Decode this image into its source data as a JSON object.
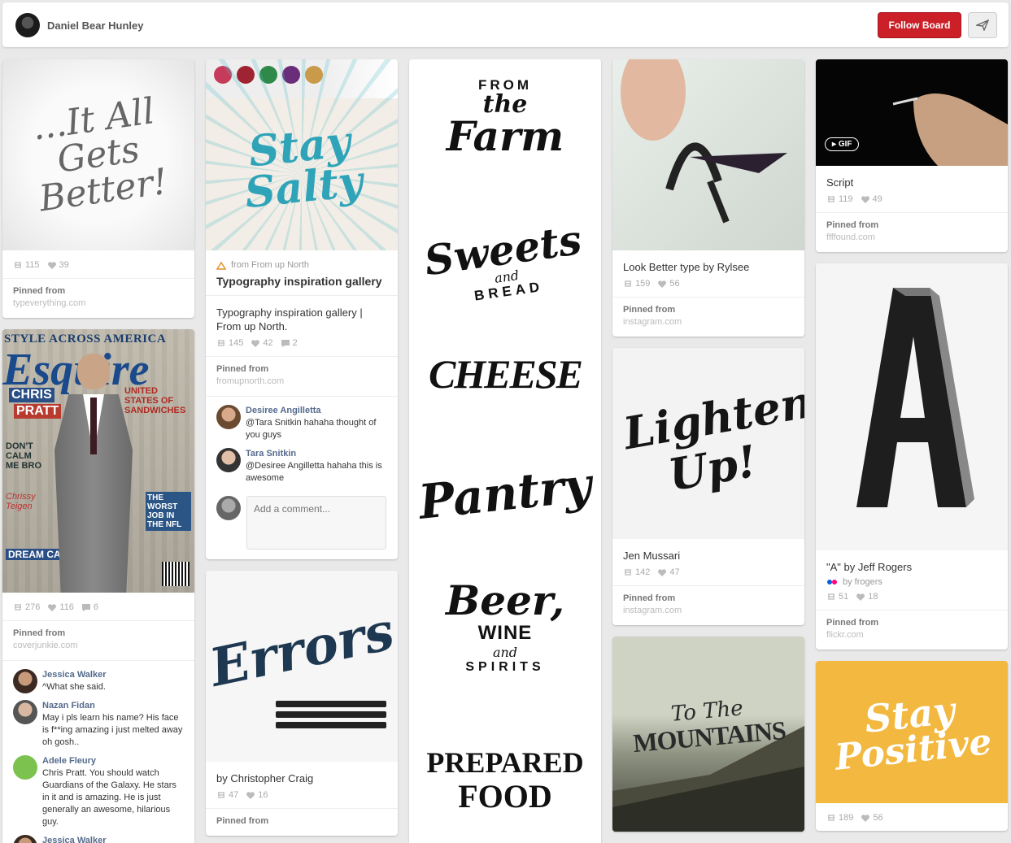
{
  "board": {
    "owner_name": "Daniel Bear Hunley",
    "follow_label": "Follow Board"
  },
  "columns": {
    "c1": {
      "pin1": {
        "likes_repins": "115",
        "likes": "39",
        "pinned_label": "Pinned from",
        "source": "typeverything.com",
        "art": "...It All Gets Better!"
      },
      "pin2": {
        "repins": "276",
        "likes": "116",
        "comments": "6",
        "pinned_label": "Pinned from",
        "source": "coverjunkie.com",
        "cover": {
          "top": "STYLE ACROSS AMERICA",
          "mast": "Esquire",
          "left1": "CHRIS",
          "left2": "PRATT",
          "right": "UNITED STATES OF SANDWICHES",
          "left3": "DON'T CALM ME BRO",
          "left4": "Chrissy Teigen",
          "left5": "DREAM CAR",
          "right2": "THE WORST JOB IN THE NFL"
        },
        "comments_list": [
          {
            "name": "Jessica Walker",
            "text": "^What she said."
          },
          {
            "name": "Nazan Fidan",
            "text": "May i pls learn his name? His face is f**ing amazing i just melted away oh gosh.."
          },
          {
            "name": "Adele Fleury",
            "text": "Chris Pratt. You should watch Guardians of the Galaxy. He stars in it and is amazing. He is just generally an awesome, hilarious guy."
          },
          {
            "name": "Jessica Walker",
            "text": ""
          }
        ]
      }
    },
    "c2": {
      "pin1": {
        "source_from": "from From up North",
        "title": "Typography inspiration gallery",
        "desc": "Typography inspiration gallery | From up North.",
        "repins": "145",
        "likes": "42",
        "comments": "2",
        "pinned_label": "Pinned from",
        "source": "fromupnorth.com",
        "art": "Stay Salty",
        "comments_list": [
          {
            "name": "Desiree Angilletta",
            "text": "@Tara Snitkin hahaha thought of you guys"
          },
          {
            "name": "Tara Snitkin",
            "text": "@Desiree Angilletta hahaha this is awesome"
          }
        ],
        "comment_placeholder": "Add a comment..."
      },
      "pin2": {
        "art": "Errors",
        "desc": "by Christopher Craig",
        "repins": "47",
        "likes": "16",
        "pinned_label": "Pinned from"
      }
    },
    "c3": {
      "pin1": {
        "art1_top": "FROM",
        "art1_mid": "the",
        "art1_main": "Farm",
        "art2_main": "Sweets",
        "art2_and": "and",
        "art2_sub": "BREAD",
        "art3": "CHEESE",
        "art4": "Pantry",
        "art5_main": "Beer,",
        "art5_wine": "WINE",
        "art5_and": "and",
        "art5_sub": "SPIRITS",
        "art6_a": "PREPARED",
        "art6_b": "FOOD"
      }
    },
    "c4": {
      "pin1": {
        "desc": "Look Better type by Rylsee",
        "repins": "159",
        "likes": "56",
        "pinned_label": "Pinned from",
        "source": "instagram.com"
      },
      "pin2": {
        "art": "Lighten Up!",
        "desc": "Jen Mussari",
        "repins": "142",
        "likes": "47",
        "pinned_label": "Pinned from",
        "source": "instagram.com"
      },
      "pin3": {
        "art_a": "To The",
        "art_b": "MOUNTAINS"
      }
    },
    "c5": {
      "pin1": {
        "gif_label": "GIF",
        "desc": "Script",
        "repins": "119",
        "likes": "49",
        "pinned_label": "Pinned from",
        "source": "ffffound.com"
      },
      "pin2": {
        "art": "A",
        "desc": "\"A\" by Jeff Rogers",
        "source_by": "by frogers",
        "repins": "51",
        "likes": "18",
        "pinned_label": "Pinned from",
        "source": "flickr.com"
      },
      "pin3": {
        "art_a": "Stay",
        "art_b": "Positive",
        "repins": "189",
        "likes": "56"
      }
    }
  },
  "colors": {
    "accent": "#cb2027",
    "background": "#e9e9e9",
    "link": "#556b8d"
  }
}
